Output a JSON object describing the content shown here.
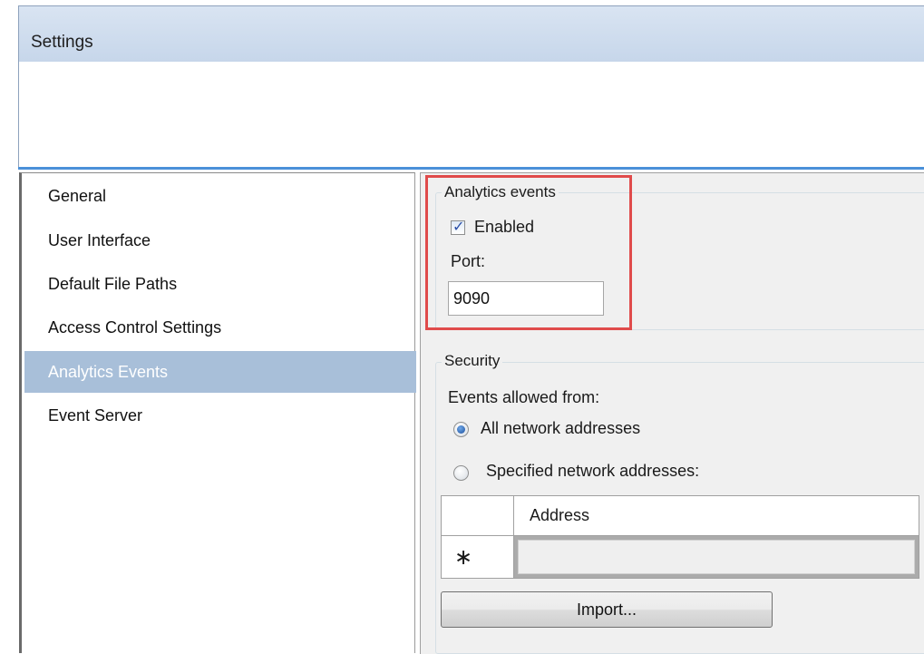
{
  "window": {
    "title": "Settings"
  },
  "nav": {
    "items": [
      {
        "label": "General",
        "selected": false
      },
      {
        "label": "User Interface",
        "selected": false
      },
      {
        "label": "Default File Paths",
        "selected": false
      },
      {
        "label": "Access Control Settings",
        "selected": false
      },
      {
        "label": "Analytics Events",
        "selected": true
      },
      {
        "label": "Event Server",
        "selected": false
      }
    ]
  },
  "analytics": {
    "group_label": "Analytics events",
    "enabled_label": "Enabled",
    "enabled_checked": true,
    "port_label": "Port:",
    "port_value": "9090"
  },
  "security": {
    "group_label": "Security",
    "allowed_from_label": "Events allowed from:",
    "options": [
      {
        "label": "All network addresses",
        "selected": true
      },
      {
        "label": "Specified network addresses:",
        "selected": false
      }
    ],
    "grid": {
      "column_header": "Address",
      "new_row_glyph": "∗"
    },
    "import_button": "Import..."
  },
  "colors": {
    "selection": "#a8bfd9",
    "highlight": "#e04b4b",
    "accent_rule": "#4a90d9"
  }
}
